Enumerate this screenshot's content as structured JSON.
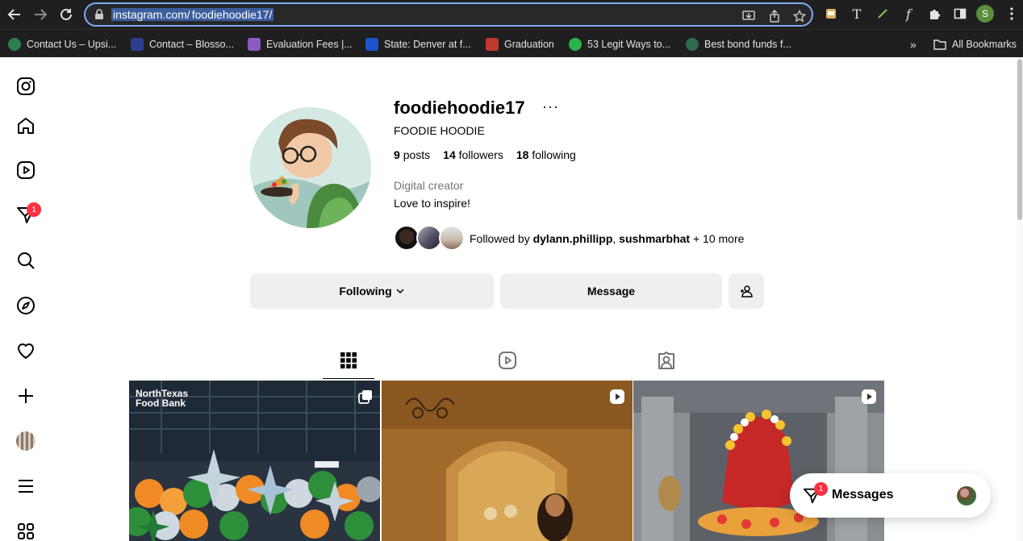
{
  "browser": {
    "url_host": "instagram.com/",
    "url_path": "foodiehoodie17/",
    "profile_initial": "S",
    "bookmarks": [
      {
        "label": "Contact Us – Upsi...",
        "color": "#2e7d4f"
      },
      {
        "label": "Contact – Blosso...",
        "color": "#2c3e8f"
      },
      {
        "label": "Evaluation Fees |...",
        "color": "#8a5cc2"
      },
      {
        "label": "State: Denver at f...",
        "color": "#1a56c9"
      },
      {
        "label": "Graduation",
        "color": "#c0392b"
      },
      {
        "label": "53 Legit Ways to...",
        "color": "#29b34a"
      },
      {
        "label": "Best bond funds f...",
        "color": "#2d6a4f"
      }
    ],
    "overflow_label": "»",
    "all_bookmarks_label": "All Bookmarks"
  },
  "left_nav": {
    "items": [
      "instagram",
      "home",
      "reels",
      "messages",
      "search",
      "explore",
      "notifications",
      "create",
      "profile",
      "more",
      "threads"
    ],
    "messages_badge": "1"
  },
  "profile": {
    "username": "foodiehoodie17",
    "more_label": "···",
    "full_name": "FOODIE HOODIE",
    "posts_count": "9",
    "posts_label": "posts",
    "followers_count": "14",
    "followers_label": "followers",
    "following_count": "18",
    "following_label": "following",
    "category": "Digital creator",
    "bio": "Love to inspire!",
    "followed_by_prefix": "Followed by",
    "followed_by_user1": "dylann.phillipp",
    "followed_by_sep": ",",
    "followed_by_user2": "sushmarbhat",
    "followed_by_suffix": "+ 10 more"
  },
  "actions": {
    "following_label": "Following",
    "message_label": "Message"
  },
  "tabs": [
    "posts",
    "reels",
    "tagged"
  ],
  "posts": [
    {
      "caption_overlay": "NorthTexas Food Bank",
      "type": "carousel"
    },
    {
      "type": "reel"
    },
    {
      "type": "reel"
    }
  ],
  "messages_pill": {
    "label": "Messages",
    "badge": "1"
  },
  "colors": {
    "accent_blue": "#0095f6",
    "badge_red": "#ff3040",
    "button_grey": "#efefef"
  }
}
